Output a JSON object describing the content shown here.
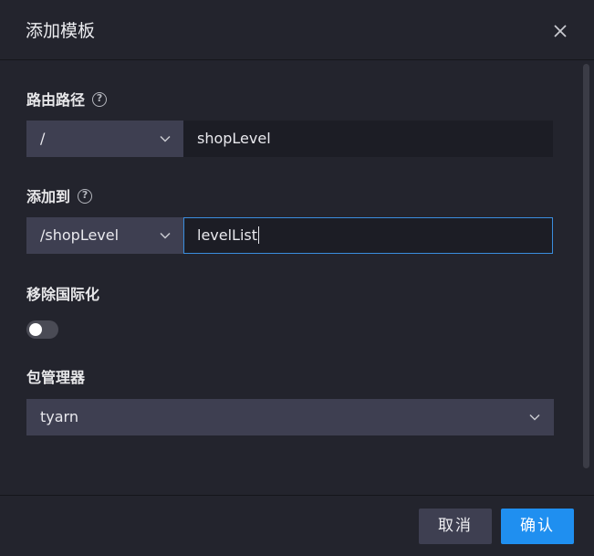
{
  "dialog": {
    "title": "添加模板",
    "close_icon": "close-icon"
  },
  "form": {
    "route": {
      "label": "路由路径",
      "help_icon": "question-circle-icon",
      "prefix_value": "/",
      "value": "shopLevel"
    },
    "add_to": {
      "label": "添加到",
      "help_icon": "question-circle-icon",
      "prefix_value": "/shopLevel",
      "value": "levelList"
    },
    "remove_i18n": {
      "label": "移除国际化",
      "enabled": false
    },
    "package_manager": {
      "label": "包管理器",
      "value": "tyarn"
    }
  },
  "footer": {
    "cancel_label": "取消",
    "ok_label": "确认"
  },
  "colors": {
    "primary": "#1f8ff0",
    "focus_border": "#3a8ddd",
    "dialog_bg": "#23242d",
    "select_bg": "#3e3f51",
    "input_bg": "#1c1d25"
  }
}
